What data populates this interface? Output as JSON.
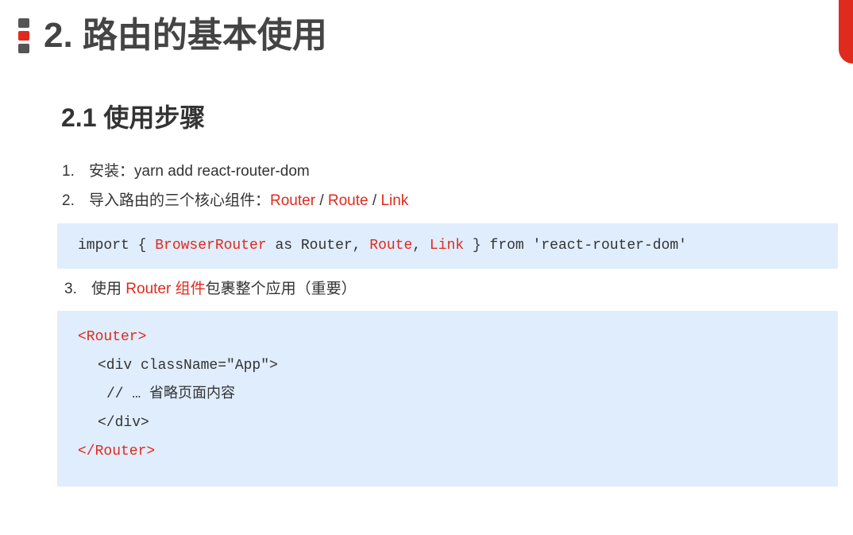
{
  "header": {
    "title": "2. 路由的基本使用"
  },
  "section": {
    "title": "2.1 使用步骤"
  },
  "steps": [
    {
      "num": "1.",
      "text": "安装：yarn add react-router-dom"
    },
    {
      "num": "2.",
      "prefix": "导入路由的三个核心组件：",
      "router": "Router",
      "sep1": " / ",
      "route": "Route",
      "sep2": " / ",
      "link": "Link"
    },
    {
      "num": "3.",
      "prefix": "使用 ",
      "highlight": "Router 组件",
      "suffix": "包裹整个应用（重要）"
    }
  ],
  "code_import": {
    "kw_import": "import { ",
    "browser_router": "BrowserRouter",
    "as_router": " as Router, ",
    "route": "Route",
    "comma": ", ",
    "link": "Link",
    "from": " } from 'react-router-dom'"
  },
  "code_usage": {
    "open_router": "<Router>",
    "open_div": "<div className=\"App\">",
    "comment": "// … 省略页面内容",
    "close_div": "</div>",
    "close_router": "</Router>"
  },
  "colors": {
    "accent": "#e02a1e",
    "code_bg": "#e0edfc",
    "text": "#333333"
  }
}
